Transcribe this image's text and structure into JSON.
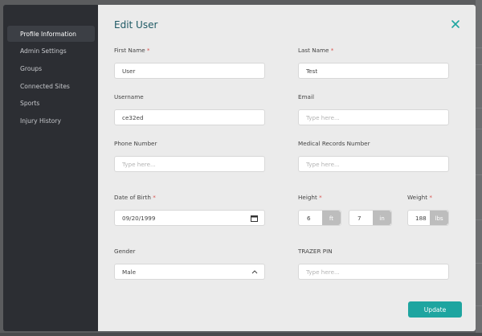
{
  "sidebar": {
    "items": [
      {
        "label": "Profile Information"
      },
      {
        "label": "Admin Settings"
      },
      {
        "label": "Groups"
      },
      {
        "label": "Connected Sites"
      },
      {
        "label": "Sports"
      },
      {
        "label": "Injury History"
      }
    ],
    "active_index": 0
  },
  "modal": {
    "title": "Edit User",
    "close_icon": "close-icon"
  },
  "form": {
    "first_name": {
      "label": "First Name",
      "required": "*",
      "value": "User"
    },
    "last_name": {
      "label": "Last Name",
      "required": "*",
      "value": "Test"
    },
    "username": {
      "label": "Username",
      "value": "ce32ed"
    },
    "email": {
      "label": "Email",
      "placeholder": "Type here..."
    },
    "phone": {
      "label": "Phone Number",
      "placeholder": "Type here..."
    },
    "mrn": {
      "label": "Medical Records Number",
      "placeholder": "Type here..."
    },
    "dob": {
      "label": "Date of Birth",
      "required": "*",
      "value": "09/20/1999",
      "icon": "calendar-icon"
    },
    "height": {
      "label": "Height",
      "required": "*",
      "feet": "6",
      "feet_unit": "ft",
      "inches": "7",
      "inches_unit": "in"
    },
    "weight": {
      "label": "Weight",
      "required": "*",
      "value": "188",
      "unit": "lbs"
    },
    "gender": {
      "label": "Gender",
      "value": "Male",
      "icon": "chevron-up-icon"
    },
    "trazer_pin": {
      "label": "TRAZER PIN",
      "placeholder": "Type here..."
    }
  },
  "actions": {
    "update_label": "Update"
  },
  "colors": {
    "accent": "#1ea5a0",
    "title": "#1e5964",
    "sidebar": "#2c2e33",
    "required": "#d9534f"
  }
}
